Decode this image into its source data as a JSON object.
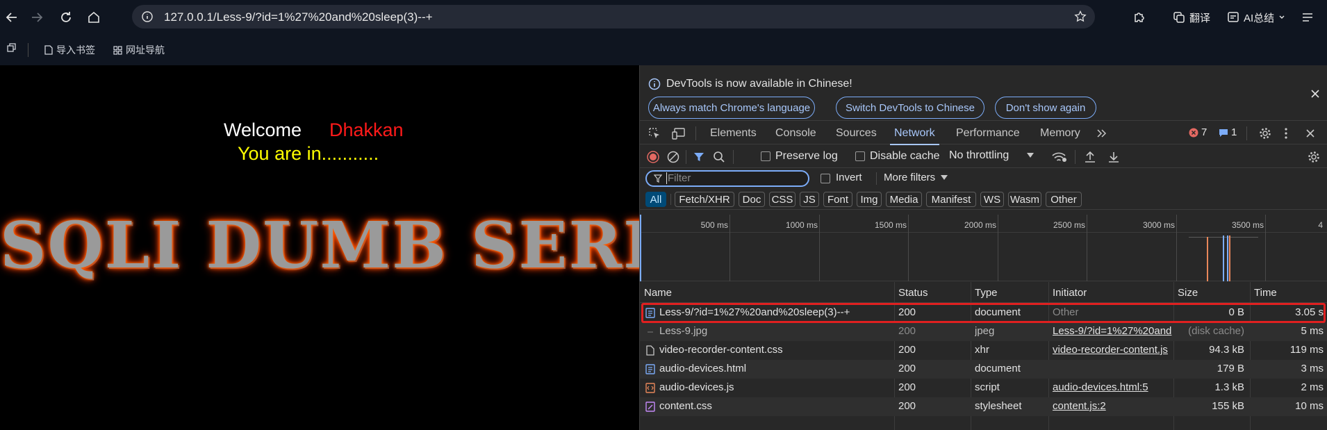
{
  "browser": {
    "url": "127.0.0.1/Less-9/?id=1%27%20and%20sleep(3)--+",
    "translate_label": "翻译",
    "ai_summary_label": "AI总结",
    "bookmarks": [
      "导入书签",
      "网址导航"
    ]
  },
  "page": {
    "welcome": "Welcome",
    "user": "Dhakkan",
    "status": "You are in...........",
    "banner": "SQLI DUMB SERIES"
  },
  "devtools": {
    "info_message": "DevTools is now available in Chinese!",
    "info_buttons": [
      "Always match Chrome's language",
      "Switch DevTools to Chinese",
      "Don't show again"
    ],
    "tabs": [
      "Elements",
      "Console",
      "Sources",
      "Network",
      "Performance",
      "Memory"
    ],
    "active_tab": "Network",
    "error_count": "7",
    "message_count": "1",
    "preserve_log": "Preserve log",
    "disable_cache": "Disable cache",
    "throttling": "No throttling",
    "filter_placeholder": "Filter",
    "invert": "Invert",
    "more_filters": "More filters",
    "type_filters": [
      "All",
      "Fetch/XHR",
      "Doc",
      "CSS",
      "JS",
      "Font",
      "Img",
      "Media",
      "Manifest",
      "WS",
      "Wasm",
      "Other"
    ],
    "timeline_ticks": [
      "500 ms",
      "1000 ms",
      "1500 ms",
      "2000 ms",
      "2500 ms",
      "3000 ms",
      "3500 ms",
      "4"
    ],
    "columns": [
      "Name",
      "Status",
      "Type",
      "Initiator",
      "Size",
      "Time"
    ],
    "requests": [
      {
        "name": "Less-9/?id=1%27%20and%20sleep(3)--+",
        "status": "200",
        "type": "document",
        "initiator": "Other",
        "size": "0 B",
        "time": "3.05 s",
        "icon": "document-icon"
      },
      {
        "name": "Less-9.jpg",
        "status": "200",
        "type": "jpeg",
        "initiator": "Less-9/?id=1%27%20and",
        "size": "(disk cache)",
        "time": "5 ms",
        "icon": "image-icon"
      },
      {
        "name": "video-recorder-content.css",
        "status": "200",
        "type": "xhr",
        "initiator": "video-recorder-content.js",
        "size": "94.3 kB",
        "time": "119 ms",
        "icon": "file-icon"
      },
      {
        "name": "audio-devices.html",
        "status": "200",
        "type": "document",
        "initiator": "",
        "size": "179 B",
        "time": "3 ms",
        "icon": "document-icon"
      },
      {
        "name": "audio-devices.js",
        "status": "200",
        "type": "script",
        "initiator": "audio-devices.html:5",
        "size": "1.3 kB",
        "time": "2 ms",
        "icon": "script-icon"
      },
      {
        "name": "content.css",
        "status": "200",
        "type": "stylesheet",
        "initiator": "content.js:2",
        "size": "155 kB",
        "time": "10 ms",
        "icon": "stylesheet-icon"
      }
    ]
  },
  "colors": {
    "accent": "#a8c7fa",
    "highlight": "#e02020",
    "error": "#e46962",
    "banner_glow": "#ff4a00"
  }
}
